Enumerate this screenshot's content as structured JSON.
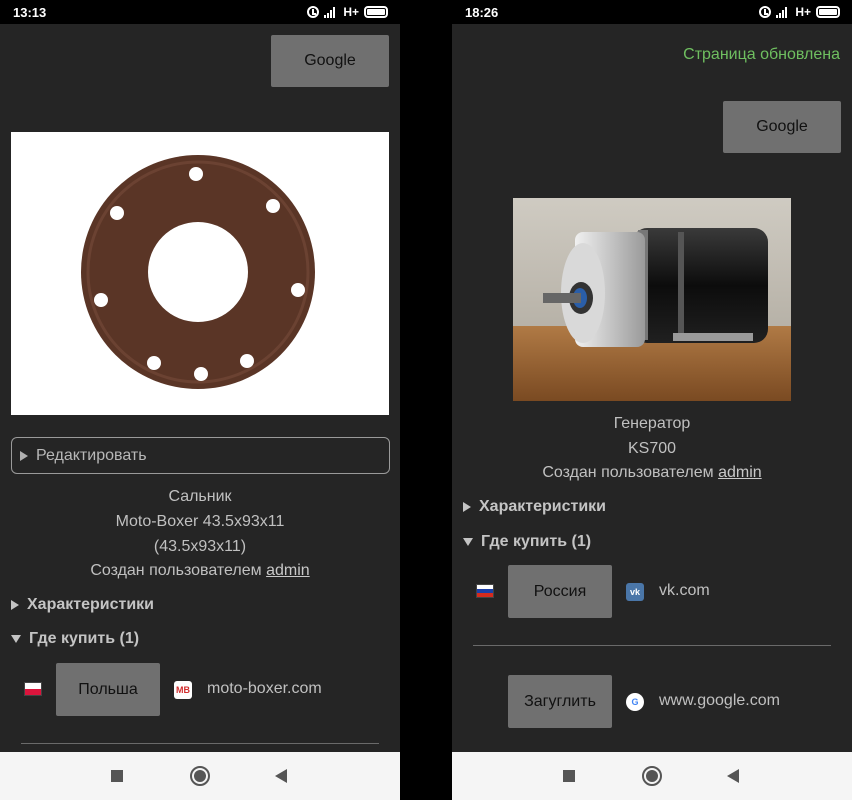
{
  "left": {
    "status_time": "13:13",
    "network": "H+",
    "google_button": "Google",
    "edit_label": "Редактировать",
    "product": {
      "name": "Сальник",
      "model": "Moto-Boxer 43.5x93x11",
      "size": "(43.5x93x11)",
      "created_by_prefix": "Создан пользователем ",
      "created_by_user": "admin"
    },
    "characteristics_label": "Характеристики",
    "where_to_buy_label": "Где купить (1)",
    "shops": [
      {
        "country_button": "Польша",
        "site": "moto-boxer.com",
        "site_icon_text": "MB"
      }
    ]
  },
  "right": {
    "status_time": "18:26",
    "network": "H+",
    "updated_notice": "Страница обновлена",
    "google_button": "Google",
    "product": {
      "name": "Генератор",
      "model": "KS700",
      "created_by_prefix": "Создан пользователем ",
      "created_by_user": "admin"
    },
    "characteristics_label": "Характеристики",
    "where_to_buy_label": "Где купить (1)",
    "shops": [
      {
        "country_button": "Россия",
        "site": "vk.com",
        "site_icon_text": "vk"
      },
      {
        "country_button": "Загуглить",
        "site": "www.google.com",
        "site_icon_text": "G"
      }
    ]
  },
  "colors": {
    "background": "#252525",
    "button": "#707070",
    "updated_notice": "#6fbf60"
  }
}
